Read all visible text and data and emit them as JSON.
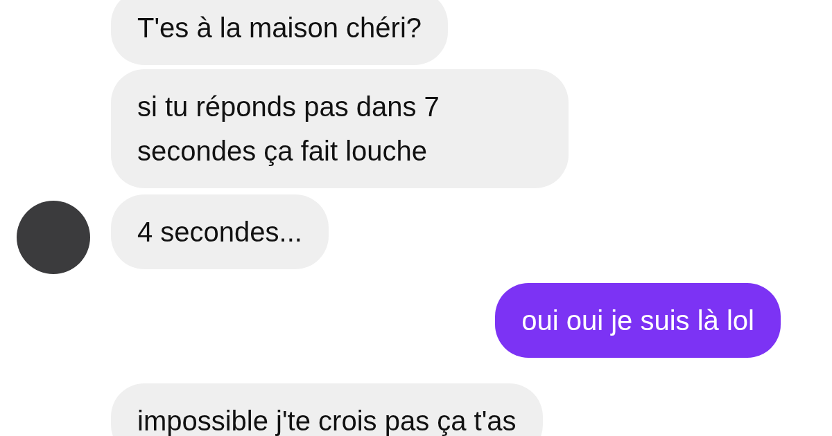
{
  "messages": [
    {
      "kind": "received",
      "avatar": false,
      "text": "T'es à la maison chéri?"
    },
    {
      "kind": "received",
      "avatar": false,
      "text": "si tu réponds pas dans 7 secondes ça fait louche"
    },
    {
      "kind": "received",
      "avatar": true,
      "text": "4 secondes..."
    },
    {
      "kind": "sent",
      "avatar": false,
      "text": "oui oui je suis là lol"
    },
    {
      "kind": "received",
      "avatar": false,
      "text": "impossible j'te crois pas ça t'as"
    }
  ]
}
